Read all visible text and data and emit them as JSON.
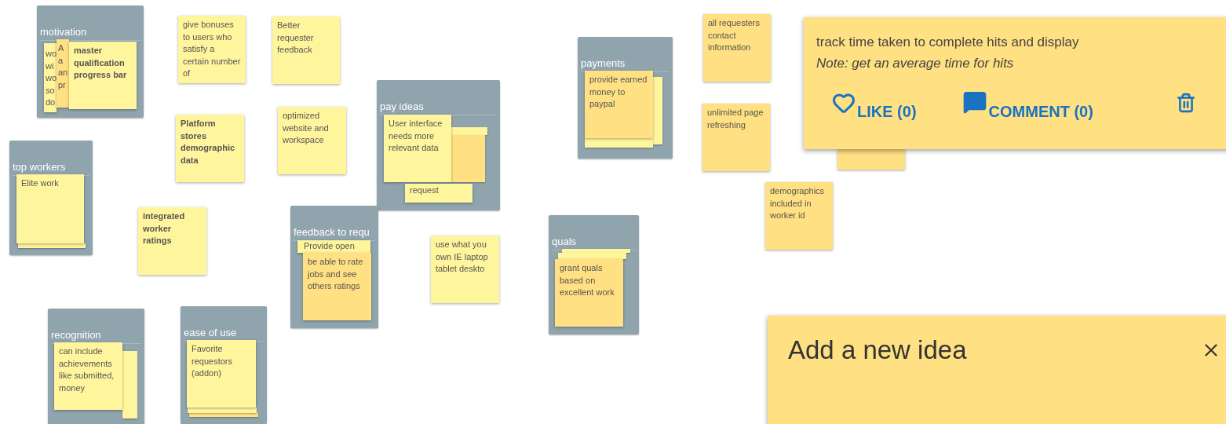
{
  "board": {
    "groups": [
      {
        "title": "motivation",
        "notes": [
          {
            "text": "wo\nwi\nwo\nso\ndo",
            "bold": false,
            "color": "#fff59d"
          },
          {
            "text": "A\na\nan\npr",
            "bold": false,
            "color": "#ffe082"
          },
          {
            "text": "master qualification progress bar",
            "bold": true,
            "color": "#fff59d"
          }
        ]
      },
      {
        "title": "top workers",
        "notes": [
          {
            "color": "#fff59d"
          },
          {
            "text": "Elite work",
            "bold": false,
            "color": "#fff59d"
          }
        ]
      },
      {
        "title": "pay ideas",
        "notes": [
          {
            "color": "#fff59d"
          },
          {
            "color": "#ffe082"
          },
          {
            "text": "User interface needs more relevant data",
            "bold": false,
            "color": "#fff59d"
          },
          {
            "text": "request",
            "bold": false,
            "color": "#fff59d"
          }
        ]
      },
      {
        "title": "feedback to requ",
        "notes": [
          {
            "text": "Provide open",
            "bold": false,
            "color": "#fff59d"
          },
          {
            "text": "be able to rate jobs and see others ratings",
            "bold": false,
            "color": "#ffe082"
          }
        ]
      },
      {
        "title": "recognition",
        "notes": [
          {
            "color": "#fff59d"
          },
          {
            "text": "can include achievements like submitted, money",
            "bold": false,
            "color": "#fff59d"
          }
        ]
      },
      {
        "title": "ease of use",
        "notes": [
          {
            "color": "#ffe082"
          },
          {
            "color": "#fff59d"
          },
          {
            "text": "Favorite requestors (addon)",
            "bold": false,
            "color": "#fff59d"
          }
        ]
      },
      {
        "title": "payments",
        "notes": [
          {
            "color": "#fff59d"
          },
          {
            "color": "#fff59d"
          },
          {
            "text": "provide earned money to paypal",
            "bold": false,
            "color": "#ffe082"
          }
        ]
      },
      {
        "title": "quals",
        "notes": [
          {
            "color": "#fff59d"
          },
          {
            "color": "#fff59d"
          },
          {
            "text": "grant quals based on excellent work",
            "bold": false,
            "color": "#ffe082"
          }
        ]
      }
    ],
    "notes": [
      {
        "text": "give bonuses to users who satisfy a certain number of",
        "bold": false,
        "color": "#fff59d"
      },
      {
        "text": "Better requester feedback",
        "bold": false,
        "color": "#fff59d"
      },
      {
        "text": "Platform stores demographic data",
        "bold": true,
        "color": "#fff59d"
      },
      {
        "text": "optimized website and workspace",
        "bold": false,
        "color": "#fff59d"
      },
      {
        "text": "integrated worker ratings",
        "bold": true,
        "color": "#fff59d"
      },
      {
        "text": "use what you own IE laptop tablet deskto",
        "bold": false,
        "color": "#fff59d"
      },
      {
        "text": "all requesters contact information",
        "bold": false,
        "color": "#ffe082"
      },
      {
        "text": "unlimited page refreshing",
        "bold": false,
        "color": "#ffe082"
      },
      {
        "text": "demographics included in worker id",
        "bold": false,
        "color": "#ffe082"
      },
      {
        "color": "#ffe082"
      }
    ]
  },
  "detail": {
    "text": "track time taken to complete hits and display",
    "note": "Note: get an average time for hits",
    "actions": [
      {
        "kind": "like",
        "label": "LIKE (0)"
      },
      {
        "kind": "comment",
        "label": "COMMENT (0)"
      },
      {
        "kind": "delete"
      }
    ]
  },
  "new_idea": {
    "title": "Add a new idea"
  }
}
